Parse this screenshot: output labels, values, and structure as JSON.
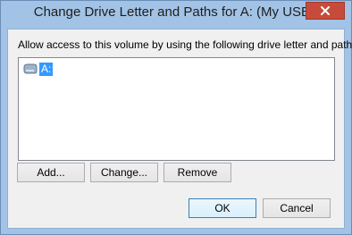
{
  "window": {
    "title": "Change Drive Letter and Paths for A: (My USB )"
  },
  "dialog": {
    "description": "Allow access to this volume by using the following drive letter and paths:",
    "paths": [
      {
        "label": "A:",
        "icon": "drive-icon",
        "selected": true
      }
    ]
  },
  "buttons": {
    "add": "Add...",
    "change": "Change...",
    "remove": "Remove",
    "ok": "OK",
    "cancel": "Cancel"
  },
  "colors": {
    "frame": "#a2c3e6",
    "close": "#c74b3b",
    "selection": "#3399ff",
    "client": "#f0f0f0"
  }
}
